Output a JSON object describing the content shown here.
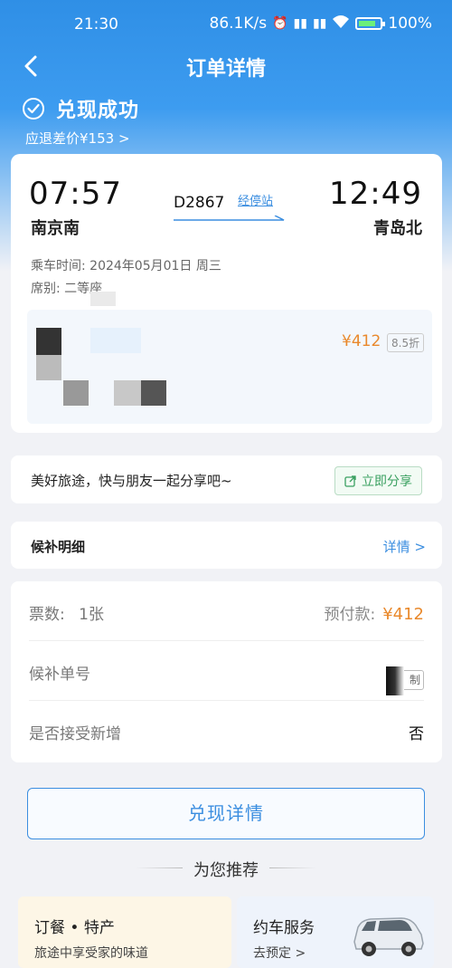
{
  "status_bar": {
    "time": "21:30",
    "net_speed": "86.1K/s",
    "battery": "100%"
  },
  "header": {
    "title": "订单详情"
  },
  "result": {
    "status": "兑现成功",
    "refund": "应退差价¥153 >"
  },
  "trip": {
    "dep_time": "07:57",
    "dep_station": "南京南",
    "arr_time": "12:49",
    "arr_station": "青岛北",
    "train_no": "D2867",
    "stops_link": "经停站",
    "ride_time": "乘车时间: 2024年05月01日 周三",
    "seat": "席别: 二等座",
    "price": "¥412",
    "discount": "8.5折"
  },
  "share": {
    "text": "美好旅途，快与朋友一起分享吧~",
    "button": "立即分享"
  },
  "waitlist": {
    "title": "候补明细",
    "detail_link": "详情 >"
  },
  "info": {
    "tickets_label": "票数:",
    "tickets_value": "1张",
    "prepay_label": "预付款:",
    "prepay_value": "¥412",
    "order_label": "候补单号",
    "copy_label": "制",
    "accept_label": "是否接受新增",
    "accept_value": "否"
  },
  "actions": {
    "redeem_button": "兑现详情"
  },
  "recommend": {
    "heading": "为您推荐",
    "tiles": [
      {
        "title": "订餐 • 特产",
        "subtitle": "旅途中享受家的味道"
      },
      {
        "title": "约车服务",
        "subtitle": "去预定 >"
      }
    ]
  },
  "colors": {
    "brand_blue": "#3b8ee0",
    "price_orange": "#e9892c",
    "share_green": "#3aa060"
  }
}
